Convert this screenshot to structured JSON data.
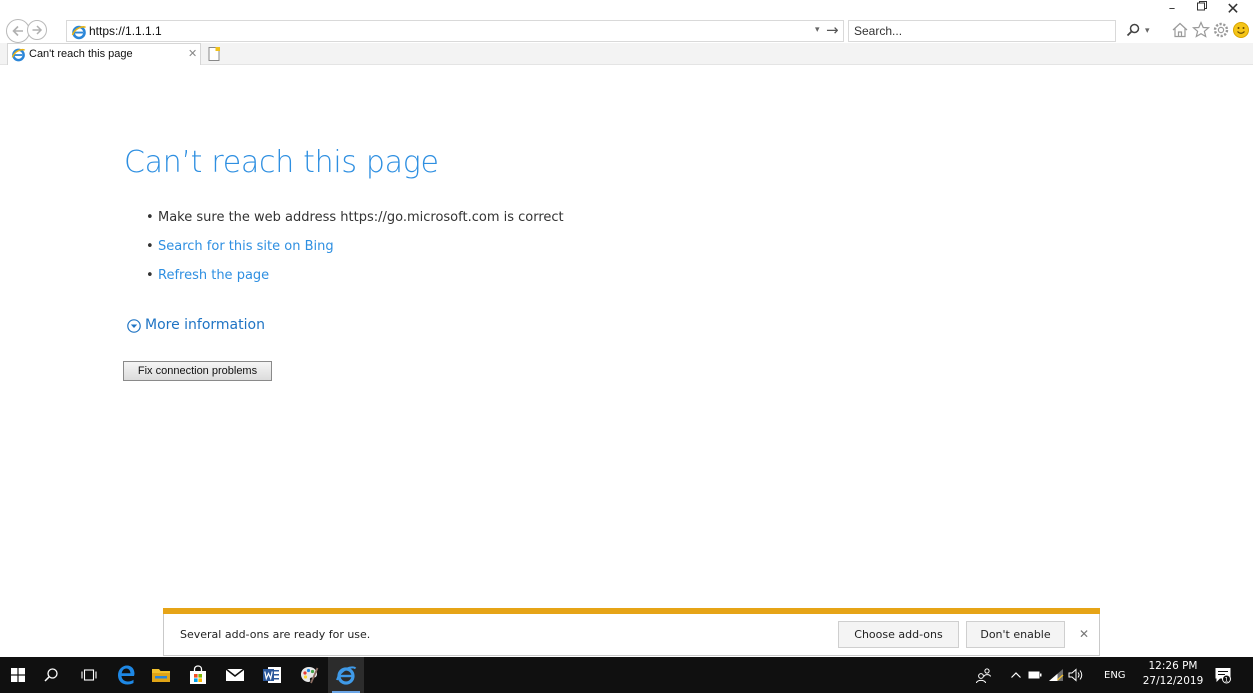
{
  "browser": {
    "address": "https://1.1.1.1",
    "search_placeholder": "Search...",
    "tab_title": "Can't reach this page",
    "icons": [
      "back-arrow-icon",
      "forward-arrow-icon",
      "ie-favicon",
      "search-icon",
      "home-icon",
      "star-icon",
      "gear-icon",
      "smiley-icon",
      "new-tab-icon"
    ]
  },
  "page": {
    "title": "Can’t reach this page",
    "bullets": [
      {
        "text": "Make sure the web address https://go.microsoft.com is correct",
        "link": false
      },
      {
        "text": "Search for this site on Bing",
        "link": true
      },
      {
        "text": "Refresh the page",
        "link": true
      }
    ],
    "more_info": "More information",
    "fix_button": "Fix connection problems"
  },
  "notification": {
    "message": "Several add-ons are ready for use.",
    "choose_label": "Choose add-ons",
    "dont_label": "Don't enable"
  },
  "taskbar": {
    "language": "ENG",
    "time": "12:26 PM",
    "date": "27/12/2019",
    "notification_count": "1"
  },
  "colors": {
    "link": "#2e8fe1",
    "notification_stripe": "#e6a417",
    "taskbar": "#101010"
  }
}
